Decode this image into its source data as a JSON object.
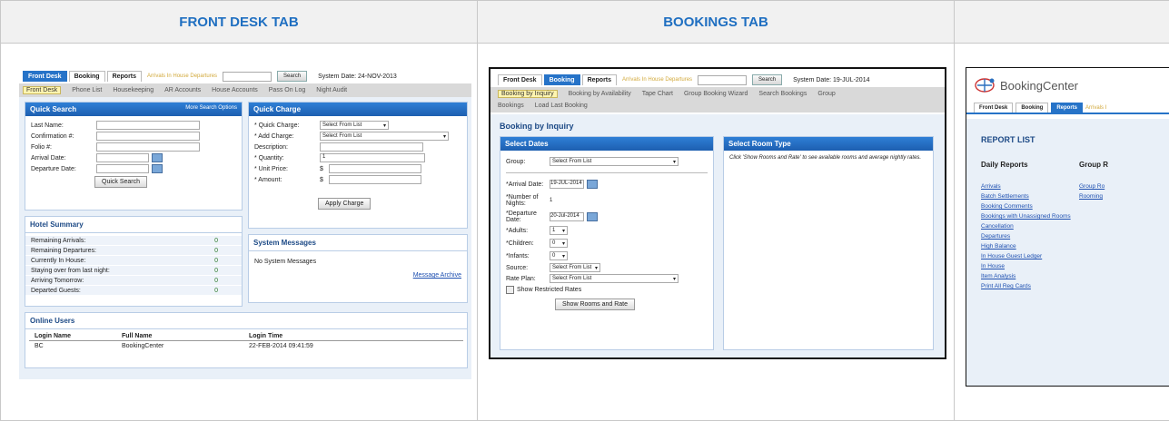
{
  "columns": {
    "front_desk": "FRONT DESK TAB",
    "bookings": "BOOKINGS TAB",
    "reports": ""
  },
  "fd": {
    "tabs": [
      "Front Desk",
      "Booking",
      "Reports"
    ],
    "ghost": "Arrivals  In House  Departures",
    "search_btn": "Search",
    "system_date": "System Date: 24-NOV-2013",
    "subnav": [
      "Front Desk",
      "Phone List",
      "Housekeeping",
      "AR Accounts",
      "House Accounts",
      "Pass On Log",
      "Night Audit"
    ],
    "quick_search": {
      "title": "Quick Search",
      "more": "More Search Options",
      "labels": [
        "Last Name:",
        "Confirmation #:",
        "Folio #:",
        "Arrival Date:",
        "Departure Date:"
      ],
      "button": "Quick Search"
    },
    "quick_charge": {
      "title": "Quick Charge",
      "labels": [
        "* Quick Charge:",
        "* Add Charge:",
        "Description:",
        "* Quantity:",
        "* Unit Price:",
        "* Amount:"
      ],
      "qc_value": "Select From List",
      "ac_value": "Select From List",
      "quantity": "1",
      "price_prefix": "$",
      "amount_prefix": "$",
      "button": "Apply Charge"
    },
    "hotel_summary": {
      "title": "Hotel Summary",
      "rows": [
        {
          "k": "Remaining Arrivals:",
          "v": "0"
        },
        {
          "k": "Remaining Departures:",
          "v": "0"
        },
        {
          "k": "Currently In House:",
          "v": "0"
        },
        {
          "k": "Staying over from last night:",
          "v": "0"
        },
        {
          "k": "Arriving Tomorrow:",
          "v": "0"
        },
        {
          "k": "Departed Guests:",
          "v": "0"
        }
      ]
    },
    "system_messages": {
      "title": "System Messages",
      "text": "No System Messages",
      "archive": "Message Archive"
    },
    "online_users": {
      "title": "Online Users",
      "headers": [
        "Login Name",
        "Full Name",
        "Login Time"
      ],
      "row": [
        "BC",
        "BookingCenter",
        "22-FEB-2014 09:41:59"
      ]
    }
  },
  "bk": {
    "tabs": [
      "Front Desk",
      "Booking",
      "Reports"
    ],
    "ghost": "Arrivals  In House  Departures",
    "search_btn": "Search",
    "system_date": "System Date: 19-JUL-2014",
    "subnav": [
      "Booking by Inquiry",
      "Booking by Availability",
      "Tape Chart",
      "Group Booking Wizard",
      "Search Bookings",
      "Group"
    ],
    "subnav2": [
      "Bookings",
      "Load Last Booking"
    ],
    "page_title": "Booking by Inquiry",
    "select_dates": {
      "title": "Select Dates",
      "group_label": "Group:",
      "group_value": "Select From List",
      "arrival_label": "*Arrival Date:",
      "arrival_value": "19-JUL-2014",
      "nights_label": "*Number of Nights:",
      "nights_value": "1",
      "departure_label": "*Departure Date:",
      "departure_value": "20-Jul-2014",
      "adults_label": "*Adults:",
      "adults_value": "1",
      "children_label": "*Children:",
      "children_value": "0",
      "infants_label": "*Infants:",
      "infants_value": "0",
      "source_label": "Source:",
      "source_value": "Select From List",
      "rate_label": "Rate Plan:",
      "rate_value": "Select From List",
      "restricted": "Show Restricted Rates",
      "button": "Show Rooms and Rate"
    },
    "room_type": {
      "title": "Select Room Type",
      "text": "Click 'Show Rooms and Rate' to see available rooms and average nightly rates."
    }
  },
  "rp": {
    "brand": "BookingCenter",
    "tabs": [
      "Front Desk",
      "Booking",
      "Reports"
    ],
    "ghost": "Arrivals  I",
    "title": "REPORT LIST",
    "daily": "Daily Reports",
    "group": "Group R",
    "daily_links": [
      "Arrivals",
      "Batch Settlements",
      "Booking Comments",
      "Bookings with Unassigned Rooms",
      "Cancellation",
      "Departures",
      "High Balance",
      "In House Guest Ledger",
      "In House",
      "Item Analysis",
      "Print All Reg Cards"
    ],
    "group_links": [
      "Group Ro",
      "Rooming"
    ]
  },
  "colors": {
    "accent": "#2673c8",
    "header_text": "#1f6fc1"
  }
}
